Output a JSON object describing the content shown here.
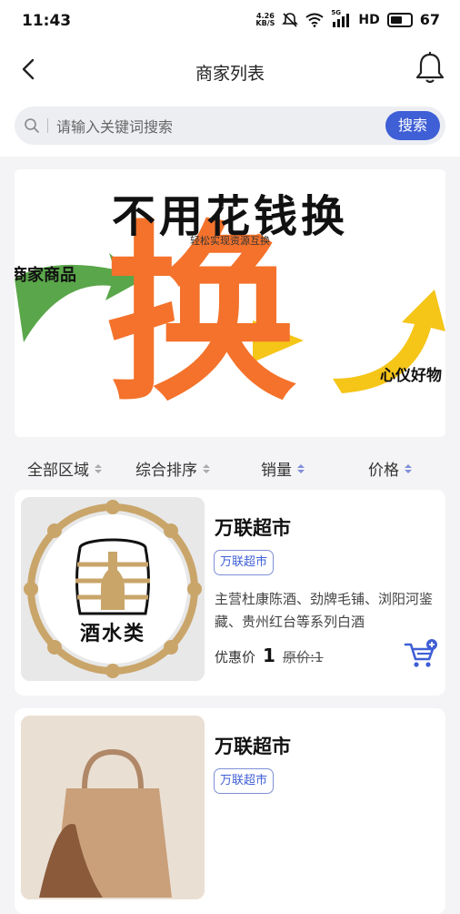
{
  "status_bar": {
    "time": "11:43",
    "speed": "4.26",
    "speed_unit": "KB/S",
    "network": "5G",
    "hd": "HD",
    "battery": "67"
  },
  "nav": {
    "title": "商家列表",
    "back_icon": "chevron-left-icon",
    "bell_icon": "bell-icon"
  },
  "search": {
    "placeholder": "请输入关键词搜索",
    "button_label": "搜索"
  },
  "banner": {
    "headline": "不用花钱换",
    "subtitle": "轻松实现资源互换",
    "left_label": "商家商品",
    "right_label": "心仪好物",
    "big_char": "换",
    "colors": {
      "orange": "#f4722b",
      "green": "#5aa64a",
      "yellow": "#f5c518"
    }
  },
  "filters": [
    {
      "label": "全部区域",
      "active": false
    },
    {
      "label": "综合排序",
      "active": false
    },
    {
      "label": "销量",
      "active": true
    },
    {
      "label": "价格",
      "active": true
    }
  ],
  "stores": [
    {
      "name": "万联超市",
      "tag": "万联超市",
      "description": "主营杜康陈酒、劲牌毛铺、浏阳河鉴藏、贵州红台等系列白酒",
      "price_label": "优惠价",
      "price": "1",
      "original_price": "原价:1",
      "image_caption": "酒水类"
    },
    {
      "name": "万联超市",
      "tag": "万联超市"
    }
  ],
  "accent_color": "#3f5fd6"
}
